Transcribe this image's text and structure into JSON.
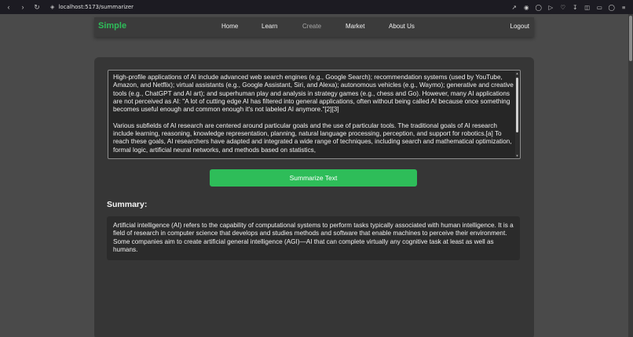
{
  "browser": {
    "url": "localhost:5173/summarizer"
  },
  "navbar": {
    "brand": "Simple",
    "links": [
      {
        "label": "Home"
      },
      {
        "label": "Learn"
      },
      {
        "label": "Create"
      },
      {
        "label": "Market"
      },
      {
        "label": "About Us"
      }
    ],
    "logout": "Logout",
    "brand_color": "#2ebd59"
  },
  "input": {
    "text": "High-profile applications of AI include advanced web search engines (e.g., Google Search); recommendation systems (used by YouTube, Amazon, and Netflix); virtual assistants (e.g., Google Assistant, Siri, and Alexa); autonomous vehicles (e.g., Waymo); generative and creative tools (e.g., ChatGPT and AI art); and superhuman play and analysis in strategy games (e.g., chess and Go). However, many AI applications are not perceived as AI: \"A lot of cutting edge AI has filtered into general applications, often without being called AI because once something becomes useful enough and common enough it's not labeled AI anymore.\"[2][3]\n\nVarious subfields of AI research are centered around particular goals and the use of particular tools. The traditional goals of AI research include learning, reasoning, knowledge representation, planning, natural language processing, perception, and support for robotics.[a] To reach these goals, AI researchers have adapted and integrated a wide range of techniques, including search and mathematical optimization, formal logic, artificial neural networks, and methods based on statistics,"
  },
  "actions": {
    "summarize_label": "Summarize Text",
    "accent_color": "#2ebd59"
  },
  "summary": {
    "heading": "Summary:",
    "text": "Artificial intelligence (AI) refers to the capability of computational systems to perform tasks typically associated with human intelligence. It is a field of research in computer science that develops and studies methods and software that enable machines to perceive their environment. Some companies aim to create artificial general intelligence (AGI)—AI that can complete virtually any cognitive task at least as well as humans."
  },
  "icons": {
    "back": "back-arrow-icon",
    "forward": "forward-arrow-icon",
    "reload": "reload-icon",
    "site_info": "site-info-icon"
  }
}
